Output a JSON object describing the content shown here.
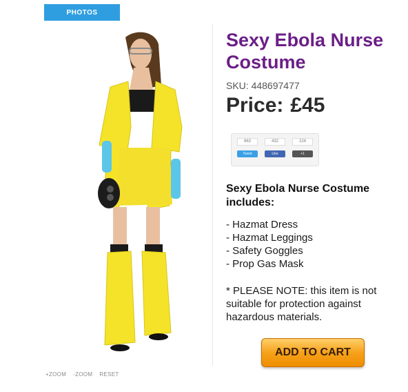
{
  "gallery": {
    "tab_label": "PHOTOS",
    "zoom_in_label": "+ZOOM",
    "zoom_out_label": "-ZOOM",
    "reset_label": "RESET"
  },
  "product": {
    "title": "Sexy Ebola Nurse Costume",
    "sku": "SKU: 448697477",
    "price_label": "Price:",
    "price_value": "£45"
  },
  "share": {
    "counts": [
      "863",
      "432",
      "224"
    ],
    "buttons": [
      "Tweet",
      "Like",
      "+1"
    ]
  },
  "includes": {
    "title": "Sexy Ebola Nurse Costume includes:",
    "items": [
      "- Hazmat Dress",
      "- Hazmat Leggings",
      "- Safety Goggles",
      "- Prop Gas Mask"
    ]
  },
  "note": "* PLEASE NOTE: this item is not suitable for protection against hazardous materials.",
  "cart": {
    "button_label": "ADD TO CART"
  },
  "colors": {
    "title_purple": "#6b1f87",
    "tab_blue": "#2f9ee0",
    "cart_orange": "#f6a21b",
    "costume_yellow": "#f5e32a"
  }
}
